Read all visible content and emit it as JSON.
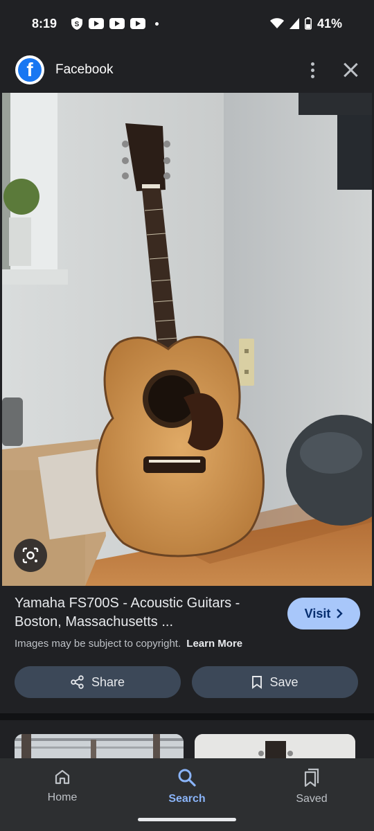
{
  "status_bar": {
    "time": "8:19",
    "battery": "41%"
  },
  "header": {
    "site_name": "Facebook",
    "logo_letter": "f"
  },
  "result": {
    "title": "Yamaha FS700S - Acoustic Guitars - Boston, Massachusetts ...",
    "visit_label": "Visit",
    "copyright_text": "Images may be subject to copyright.",
    "learn_more_label": "Learn More",
    "share_label": "Share",
    "save_label": "Save"
  },
  "bottom_nav": {
    "items": [
      {
        "label": "Home",
        "icon": "home-icon"
      },
      {
        "label": "Search",
        "icon": "search-icon",
        "active": true
      },
      {
        "label": "Saved",
        "icon": "saved-icon"
      }
    ]
  },
  "colors": {
    "background": "#202124",
    "accent": "#8ab4f8",
    "visit_button": "#a8c7fa",
    "action_button": "#3c4858",
    "facebook_blue": "#1877f2"
  }
}
